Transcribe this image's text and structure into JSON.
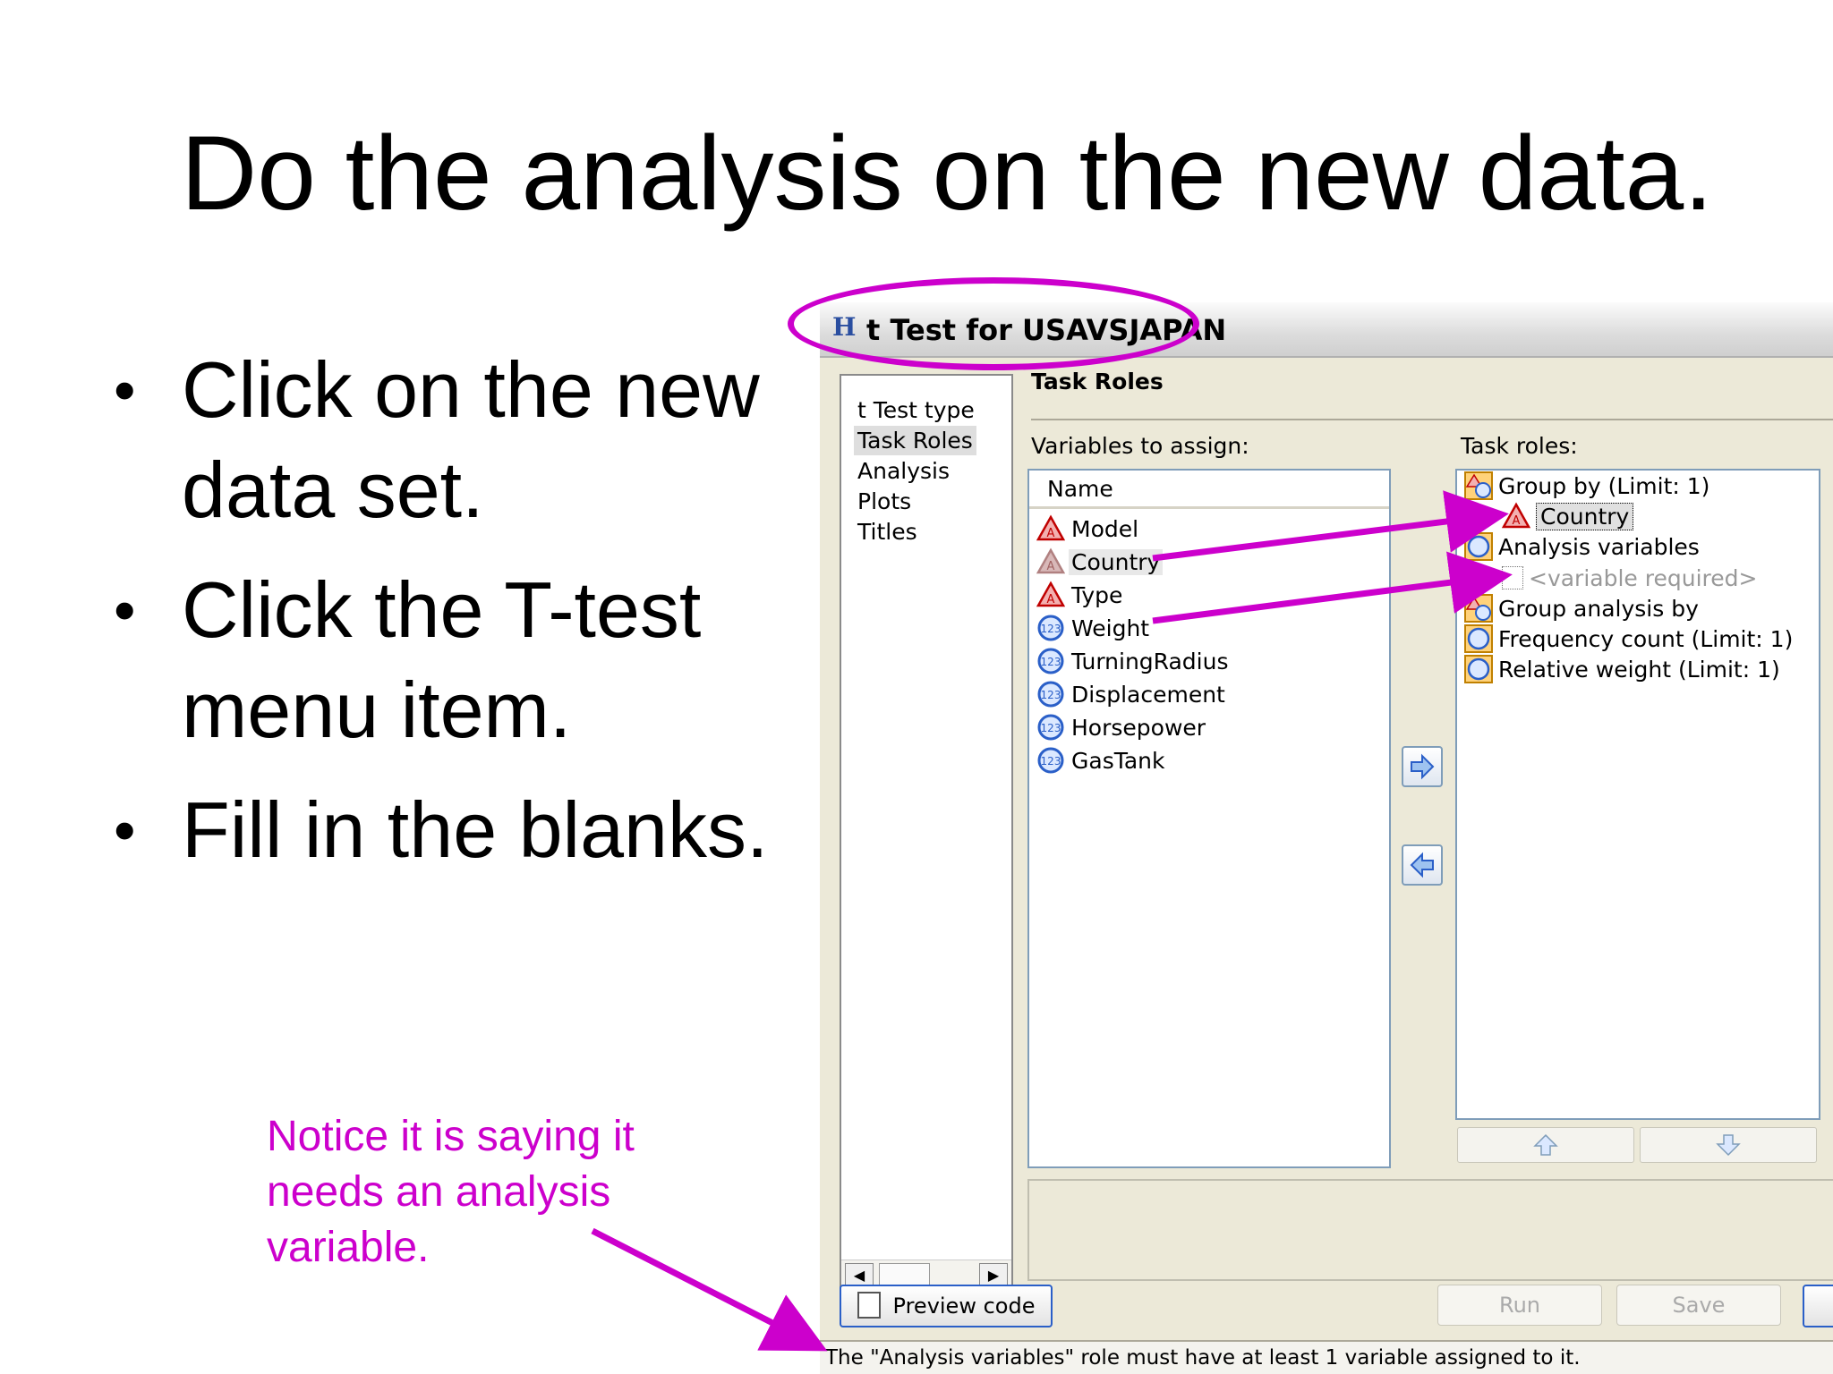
{
  "slide": {
    "title": "Do the analysis on the new data.",
    "bullets": [
      "Click on the new data set.",
      "Click the T-test menu item.",
      "Fill in the blanks."
    ],
    "annotation": "Notice it is saying it needs an analysis variable.",
    "accent_color": "#cc00cc"
  },
  "dialog": {
    "title": "t Test for USAVSJAPAN",
    "nav_items": [
      "t Test type",
      "Task Roles",
      "Analysis",
      "Plots",
      "Titles"
    ],
    "selected_nav": "Task Roles",
    "section_header": "Task Roles",
    "variables_label": "Variables to assign:",
    "roles_label": "Task roles:",
    "column_header": "Name",
    "variables": [
      {
        "name": "Model",
        "icon": "character-variable-icon"
      },
      {
        "name": "Country",
        "icon": "character-variable-icon"
      },
      {
        "name": "Type",
        "icon": "character-variable-icon"
      },
      {
        "name": "Weight",
        "icon": "numeric-variable-icon"
      },
      {
        "name": "TurningRadius",
        "icon": "numeric-variable-icon"
      },
      {
        "name": "Displacement",
        "icon": "numeric-variable-icon"
      },
      {
        "name": "Horsepower",
        "icon": "numeric-variable-icon"
      },
      {
        "name": "GasTank",
        "icon": "numeric-variable-icon"
      }
    ],
    "roles": [
      {
        "label": "Group by  (Limit: 1)",
        "icon": "group-role-icon"
      },
      {
        "label": "Country",
        "icon": "character-variable-icon",
        "assigned": true
      },
      {
        "label": "Analysis variables",
        "icon": "numeric-role-icon"
      },
      {
        "label": "<variable required>",
        "icon": "empty-slot-icon",
        "placeholder": true
      },
      {
        "label": "Group analysis by",
        "icon": "group-role-icon"
      },
      {
        "label": "Frequency count  (Limit: 1)",
        "icon": "numeric-role-icon"
      },
      {
        "label": "Relative weight  (Limit: 1)",
        "icon": "numeric-role-icon"
      }
    ],
    "buttons": {
      "preview": "Preview code",
      "run": "Run",
      "save": "Save"
    },
    "status_message": "The \"Analysis variables\" role must have at least 1 variable assigned to it."
  }
}
